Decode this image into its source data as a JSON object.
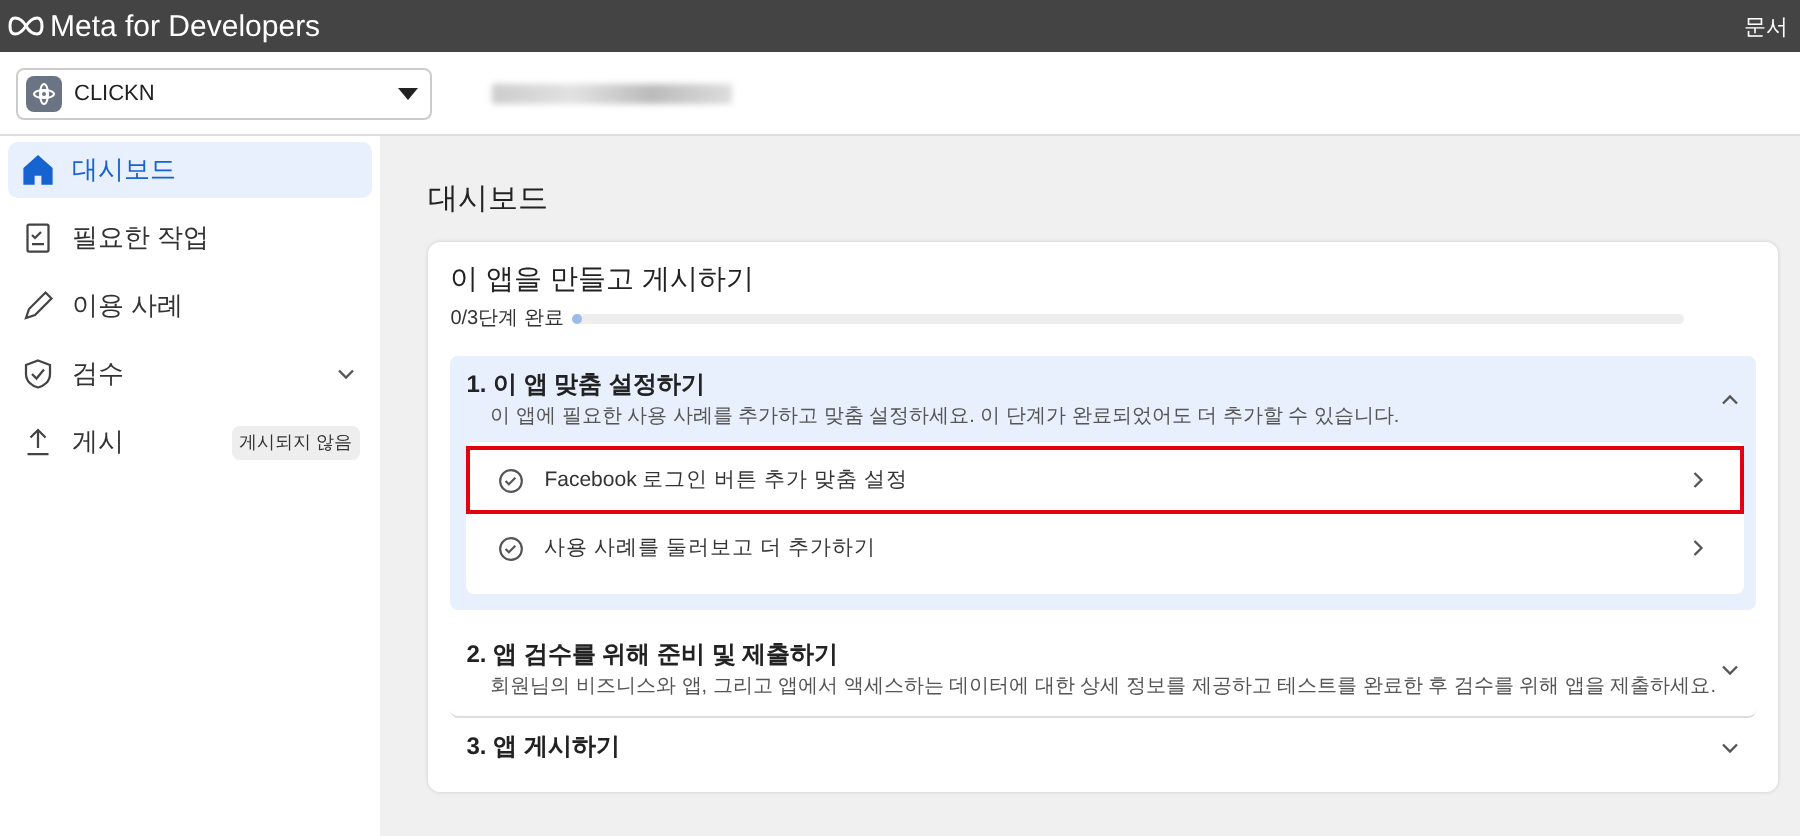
{
  "topbar": {
    "brand": "Meta for Developers",
    "link": "문서"
  },
  "app_selector": {
    "name": "CLICKN"
  },
  "sidebar": {
    "items": [
      {
        "label": "대시보드",
        "selected": true
      },
      {
        "label": "필요한 작업",
        "selected": false
      },
      {
        "label": "이용 사례",
        "selected": false
      },
      {
        "label": "검수",
        "selected": false,
        "expandable": true
      },
      {
        "label": "게시",
        "selected": false,
        "badge": "게시되지 않음"
      }
    ]
  },
  "page_title": "대시보드",
  "card": {
    "title": "이 앱을 만들고 게시하기",
    "progress_label": "0/3단계 완료",
    "level": 0.01,
    "steps": [
      {
        "title": "1. 이 앱 맞춤 설정하기",
        "description": "이 앱에 필요한 사용 사례를 추가하고 맞춤 설정하세요. 이 단계가 완료되었어도 더 추가할 수 있습니다.",
        "expanded": true,
        "tasks": [
          {
            "label": "Facebook 로그인 버튼 추가 맞춤 설정",
            "highlighted": true
          },
          {
            "label": "사용 사례를 둘러보고 더 추가하기",
            "highlighted": false
          }
        ]
      },
      {
        "title": "2. 앱 검수를 위해 준비 및 제출하기",
        "description": "회원님의 비즈니스와 앱, 그리고 앱에서 액세스하는 데이터에 대한 상세 정보를 제공하고 테스트를 완료한 후 검수를 위해 앱을 제출하세요.",
        "expanded": false
      },
      {
        "title": "3. 앱 게시하기",
        "expanded": false
      }
    ]
  }
}
